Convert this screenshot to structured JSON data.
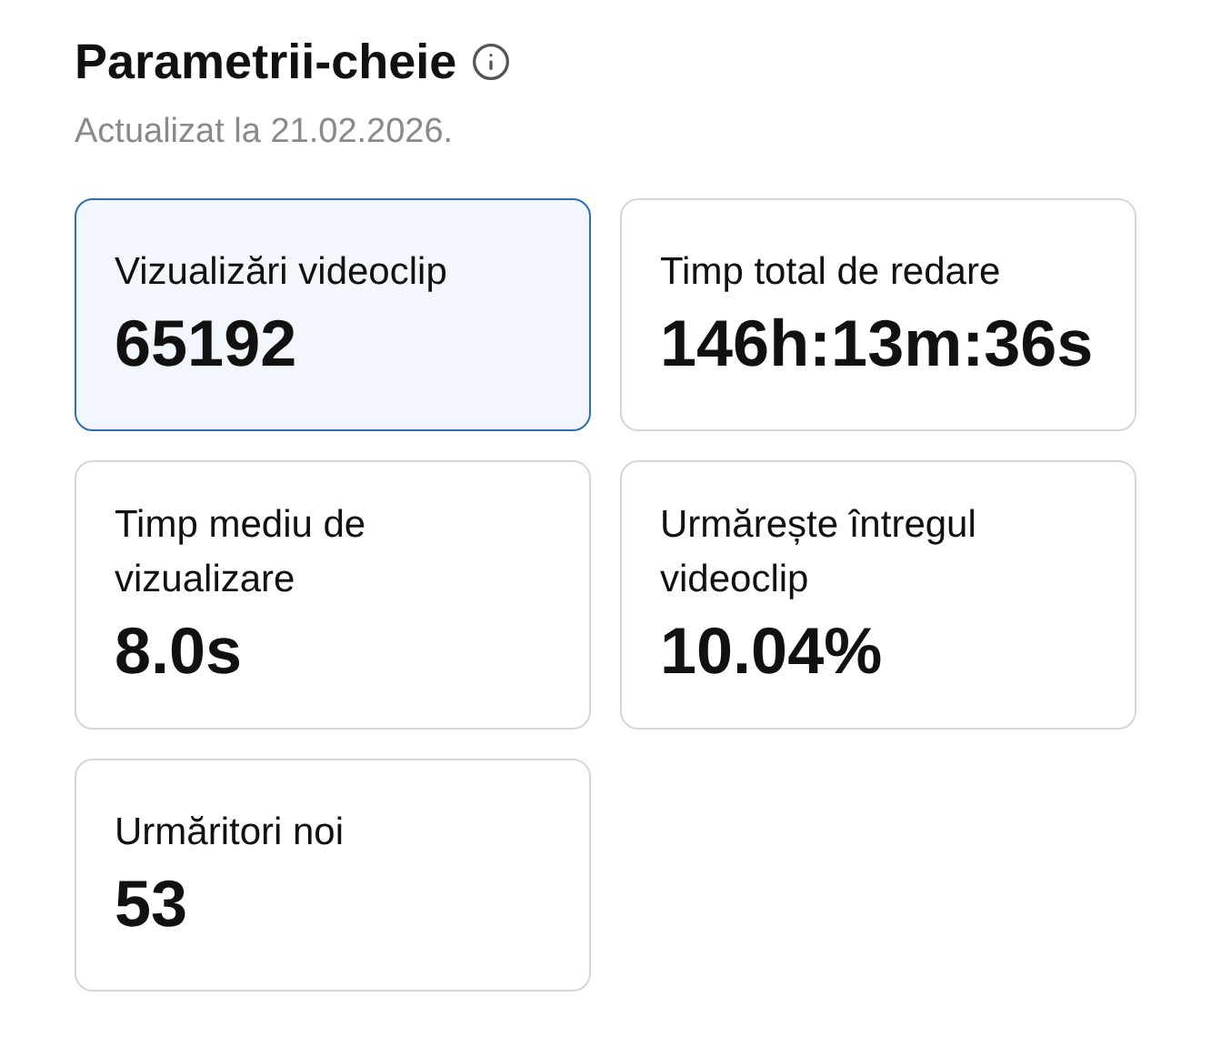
{
  "header": {
    "title": "Parametrii-cheie",
    "subtitle": "Actualizat la 21.02.2026."
  },
  "metrics": [
    {
      "label": "Vizualizări videoclip",
      "value": "65192",
      "selected": true
    },
    {
      "label": "Timp total de redare",
      "value": "146h:13m:36s",
      "selected": false
    },
    {
      "label": "Timp mediu de vizualizare",
      "value": "8.0s",
      "selected": false
    },
    {
      "label": "Urmărește întregul videoclip",
      "value": "10.04%",
      "selected": false
    },
    {
      "label": "Urmăritori noi",
      "value": "53",
      "selected": false
    }
  ]
}
